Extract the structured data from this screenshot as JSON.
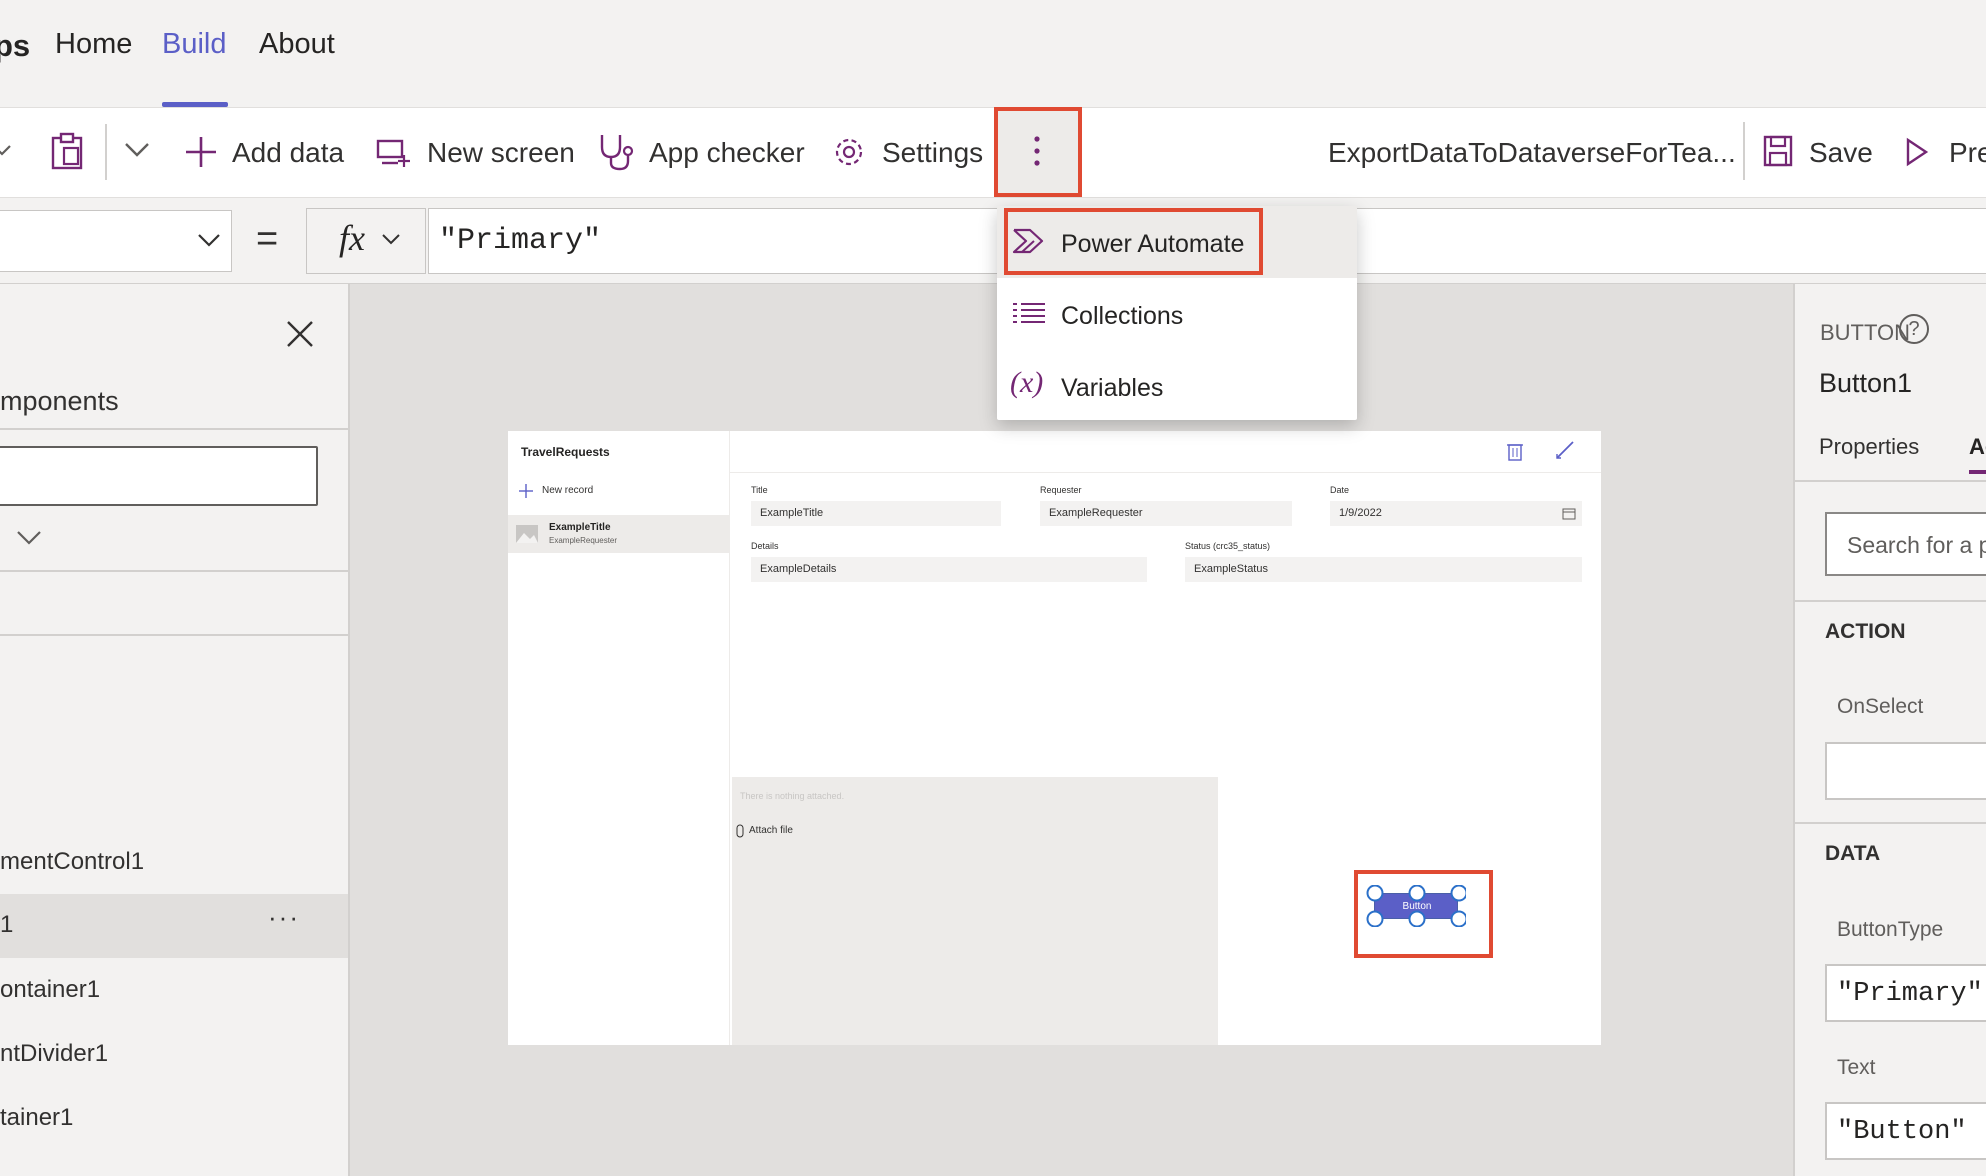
{
  "nav": {
    "app_fragment": "ps",
    "tabs": [
      "Home",
      "Build",
      "About"
    ]
  },
  "toolbar": {
    "add_data": "Add data",
    "new_screen": "New screen",
    "app_checker": "App checker",
    "settings": "Settings",
    "app_name": "ExportDataToDataverseForTea...",
    "save": "Save",
    "preview": "Pre"
  },
  "formula": {
    "equals": "=",
    "fx": "fx",
    "value": "\"Primary\""
  },
  "menu": {
    "items": [
      "Power Automate",
      "Collections",
      "Variables"
    ]
  },
  "left_panel": {
    "heading": "mponents",
    "tree": [
      "mentControl1",
      "1",
      "ontainer1",
      "ntDivider1",
      "tainer1"
    ],
    "more": "···"
  },
  "app": {
    "list_title": "TravelRequests",
    "new_record": "New record",
    "record_title": "ExampleTitle",
    "record_sub": "ExampleRequester",
    "labels": {
      "title": "Title",
      "requester": "Requester",
      "date": "Date",
      "details": "Details",
      "status": "Status (crc35_status)"
    },
    "values": {
      "title": "ExampleTitle",
      "requester": "ExampleRequester",
      "date": "1/9/2022",
      "details": "ExampleDetails",
      "status": "ExampleStatus"
    },
    "attach_empty": "There is nothing attached.",
    "attach_file": "Attach file",
    "button_text": "Button"
  },
  "right_panel": {
    "type": "BUTTON",
    "help": "?",
    "name": "Button1",
    "tab_properties": "Properties",
    "tab_advanced": "Ad",
    "search_placeholder": "Search for a p",
    "section_action": "ACTION",
    "onselect_label": "OnSelect",
    "onselect_value": "",
    "section_data": "DATA",
    "buttontype_label": "ButtonType",
    "buttontype_value": "\"Primary\"",
    "text_label": "Text",
    "text_value": "\"Button\""
  },
  "colors": {
    "accent": "#5b5fc7",
    "highlight": "#e04a32",
    "icon_purple": "#742774"
  }
}
